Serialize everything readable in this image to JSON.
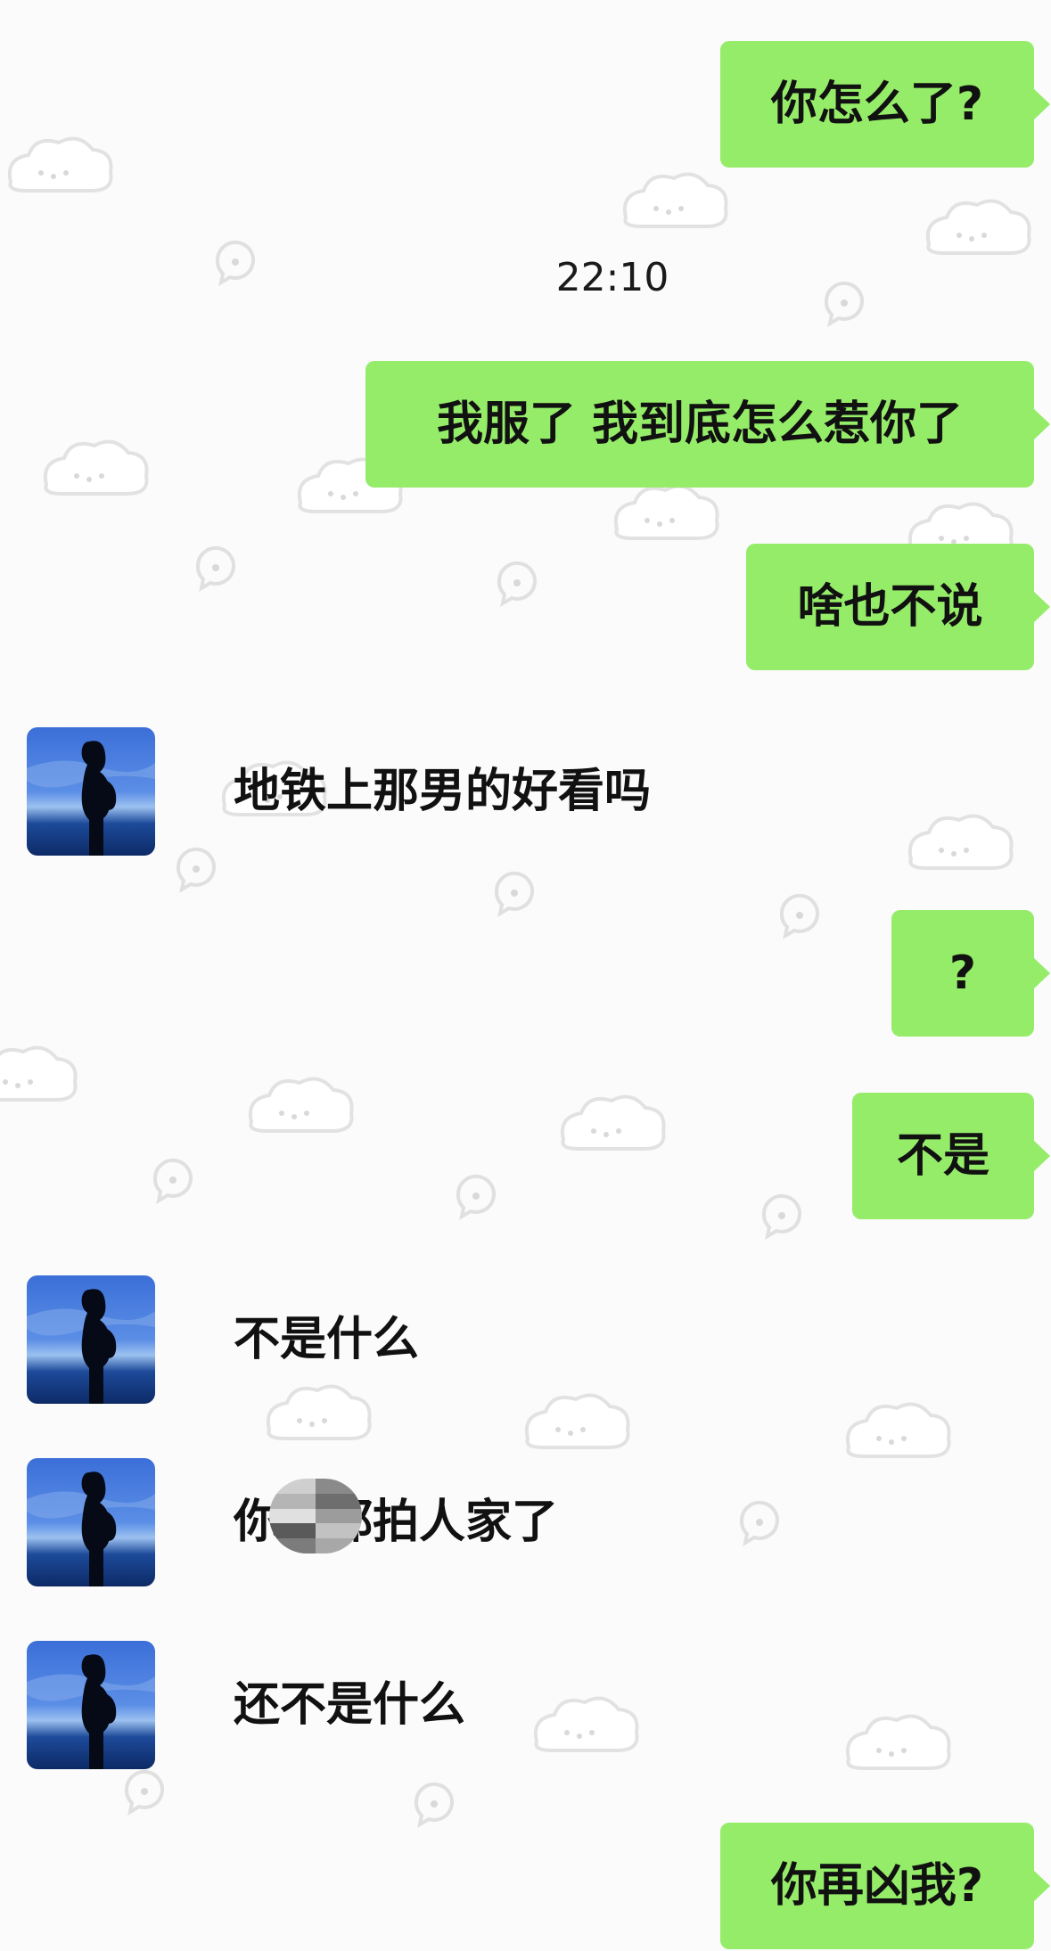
{
  "chat": {
    "timestamp": "22:10",
    "messages": [
      {
        "side": "out",
        "text": "你怎么了?"
      },
      {
        "side": "out",
        "text": "我服了 我到底怎么惹你了"
      },
      {
        "side": "out",
        "text": "啥也不说"
      },
      {
        "side": "in",
        "text": "地铁上那男的好看吗"
      },
      {
        "side": "out",
        "text": "?"
      },
      {
        "side": "out",
        "text": "不是"
      },
      {
        "side": "in",
        "text": "不是什么"
      },
      {
        "side": "in",
        "text_before": "你",
        "text_redacted": "他",
        "text_after": "都拍人家了"
      },
      {
        "side": "in",
        "text": "还不是什么"
      },
      {
        "side": "out",
        "text": "你再凶我?"
      }
    ]
  },
  "colors": {
    "outgoing_bubble": "#95ec69",
    "background": "#fbfbfb",
    "text": "#111111"
  },
  "icons": {
    "avatar": "silhouette-avatar",
    "redaction": "mosaic-blur",
    "background_pattern": "cloud-doodle-pattern"
  }
}
